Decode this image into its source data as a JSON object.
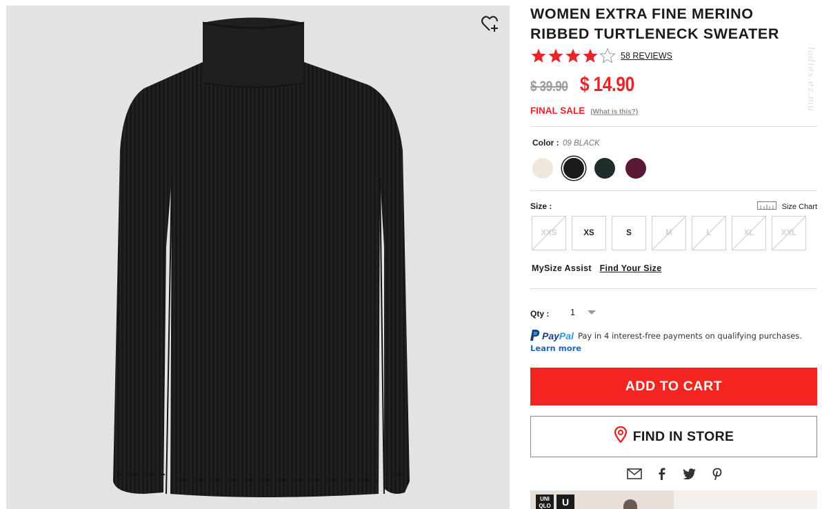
{
  "product": {
    "title": "WOMEN EXTRA FINE MERINO RIBBED TURTLENECK SWEATER",
    "rating": 4,
    "rating_max": 5,
    "reviews_label": "58 REVIEWS",
    "price_original": "$ 39.90",
    "price_sale": "$ 14.90",
    "final_sale_label": "FINAL SALE",
    "what_is_this": "(What is this?)"
  },
  "color": {
    "label": "Color :",
    "selected_value": "09 BLACK",
    "swatches": [
      {
        "name": "off-white",
        "hex": "#efe7dc",
        "selected": false
      },
      {
        "name": "black",
        "hex": "#1a1a1a",
        "selected": true
      },
      {
        "name": "dark-green",
        "hex": "#1f2e2c",
        "selected": false
      },
      {
        "name": "wine",
        "hex": "#5a1a35",
        "selected": false
      }
    ]
  },
  "size": {
    "label": "Size :",
    "chart_label": "Size Chart",
    "options": [
      {
        "label": "XXS",
        "available": false
      },
      {
        "label": "XS",
        "available": true
      },
      {
        "label": "S",
        "available": true
      },
      {
        "label": "M",
        "available": false
      },
      {
        "label": "L",
        "available": false
      },
      {
        "label": "XL",
        "available": false
      },
      {
        "label": "XXL",
        "available": false
      }
    ]
  },
  "mysize": {
    "label": "MySize Assist",
    "link": "Find Your Size"
  },
  "qty": {
    "label": "Qty :",
    "value": "1"
  },
  "paypal": {
    "brand_pay": "Pay",
    "brand_pal": "Pal",
    "text": "Pay in 4 interest-free payments on qualifying purchases.",
    "learn_more": "Learn more"
  },
  "buttons": {
    "add_to_cart": "ADD TO CART",
    "find_in_store": "FIND IN STORE"
  },
  "share_icons": [
    "mail-icon",
    "facebook-icon",
    "twitter-icon",
    "pinterest-icon"
  ],
  "banner": {
    "logo_text": "UNI QLO",
    "logo_mark": "U"
  },
  "watermark": "ladies.ez.mu",
  "colors": {
    "accent_red": "#e8262a",
    "button_red": "#f22520",
    "image_bg": "#e3e3e4"
  }
}
